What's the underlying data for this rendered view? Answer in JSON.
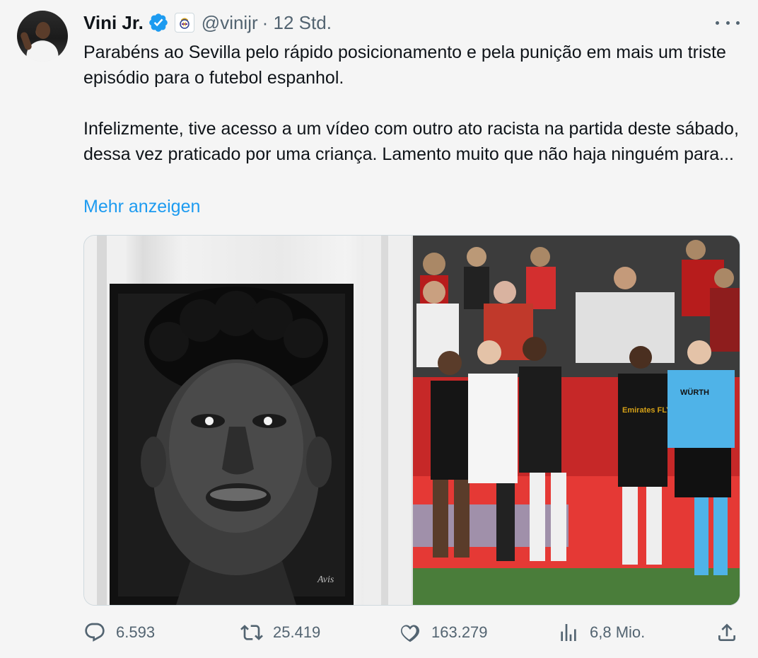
{
  "author": {
    "name": "Vini Jr.",
    "handle": "@vinijr",
    "time": "· 12 Std.",
    "verified_color": "#1d9bf0"
  },
  "tweet": {
    "paragraph1": "Parabéns ao Sevilla pelo rápido posicionamento e pela punição em mais um triste episódio para o futebol espanhol.",
    "paragraph2": "Infelizmente, tive acesso a um vídeo com outro ato racista na partida deste sábado, dessa vez praticado por uma criança. Lamento muito que não haja ninguém para...",
    "show_more": "Mehr anzeigen"
  },
  "media": {
    "signature": "Avis",
    "sponsor_shirt": "Emirates FLY BETTER",
    "referee_badge": "WÜRTH"
  },
  "stats": {
    "replies": "6.593",
    "reposts": "25.419",
    "likes": "163.279",
    "views": "6,8 Mio."
  },
  "icons": {
    "reply": "reply-icon",
    "repost": "repost-icon",
    "like": "heart-icon",
    "views": "views-icon",
    "share": "share-icon",
    "more": "more-dots-icon",
    "verified": "verified-badge-icon",
    "affiliate": "real-madrid-crest-icon"
  },
  "colors": {
    "accent": "#1d9bf0",
    "muted": "#536471",
    "text": "#0f1419"
  }
}
